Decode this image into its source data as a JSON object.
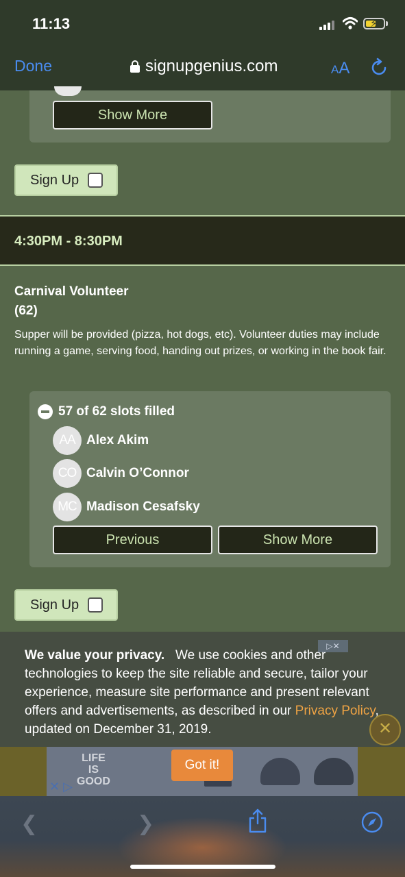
{
  "status_bar": {
    "time": "11:13"
  },
  "browser": {
    "done_label": "Done",
    "url": "signupgenius.com",
    "text_size_small": "A",
    "text_size_large": "A"
  },
  "top_section": {
    "show_more_label": "Show More",
    "signup_label": "Sign Up"
  },
  "time_slot": {
    "label": "4:30PM - 8:30PM"
  },
  "slot": {
    "title": "Carnival Volunteer",
    "count": "(62)",
    "description": "Supper will be provided (pizza, hot dogs, etc). Volunteer duties may include running a game, serving food, handing out prizes, or working in the book fair.",
    "filled_text": "57 of 62 slots filled",
    "volunteers": [
      {
        "initials": "AA",
        "name": "Alex Akim"
      },
      {
        "initials": "CO",
        "name": "Calvin O’Connor"
      },
      {
        "initials": "MC",
        "name": "Madison Cesafsky"
      }
    ],
    "previous_label": "Previous",
    "show_more_label": "Show More",
    "signup_label": "Sign Up"
  },
  "cookie_banner": {
    "heading": "We value your privacy.",
    "body": "We use cookies and other technologies to keep the site reliable and secure, tailor your experience, measure site performance and present relevant offers and advertisements, as described in our",
    "link": "Privacy Policy",
    "suffix": ", updated on December 31, 2019.",
    "accept_label": "Got it!"
  },
  "ad": {
    "brand_line1": "LIFE",
    "brand_line2": "IS",
    "brand_line3": "GOOD"
  },
  "colors": {
    "page_bg": "#56674a",
    "accent_link": "#4a8cf0",
    "cookie_link": "#f0a444",
    "got_it": "#e8893b"
  }
}
